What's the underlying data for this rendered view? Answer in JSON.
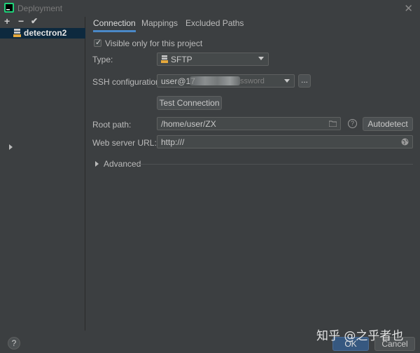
{
  "window": {
    "title": "Deployment"
  },
  "toolbar": {
    "add": "+",
    "remove": "−",
    "apply": "✔"
  },
  "tree": {
    "item_label": "detectron2"
  },
  "tabs": [
    {
      "label": "Connection"
    },
    {
      "label": "Mappings"
    },
    {
      "label": "Excluded Paths"
    }
  ],
  "connection": {
    "visible_only_label": "Visible only for this project",
    "type_label": "Type:",
    "type_value": "SFTP",
    "ssh_label": "SSH configuration:",
    "ssh_value_visible": "user@17",
    "ssh_value_faded": "ssword",
    "ssh_more_button": "...",
    "test_connection_button": "Test Connection",
    "root_path_label": "Root path:",
    "root_path_value": "/home/user/ZX",
    "autodetect_button": "Autodetect",
    "web_url_label": "Web server URL:",
    "web_url_value": "http:///",
    "help_glyph": "?",
    "advanced_label": "Advanced"
  },
  "footer": {
    "help_glyph": "?",
    "ok_button": "OK",
    "cancel_button": "Cancel",
    "watermark": "知乎 @之乎者也"
  },
  "colors": {
    "background": "#3c3f41",
    "selection": "#0d293e",
    "accent": "#4a88c7",
    "primary_button": "#365880"
  },
  "icons": {
    "app": "intellij-icon",
    "close": "close-icon",
    "tree_item": "sftp-server-icon",
    "type": "sftp-icon",
    "folder": "folder-icon",
    "globe": "globe-icon",
    "advanced": "chevron-right-icon"
  }
}
